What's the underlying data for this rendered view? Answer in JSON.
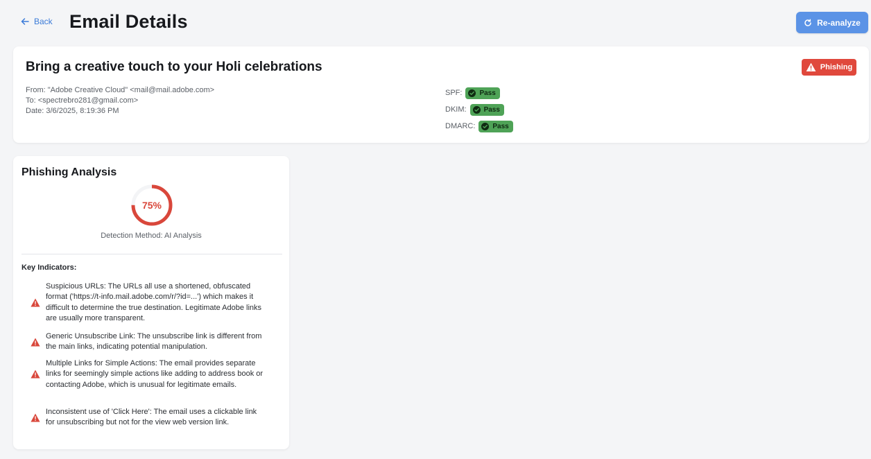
{
  "header": {
    "back_label": "Back",
    "title": "Email Details",
    "reanalyze_label": "Re-analyze"
  },
  "email": {
    "subject": "Bring a creative touch to your Holi celebrations",
    "verdict": "Phishing",
    "from": "From: \"Adobe Creative Cloud\" <mail@mail.adobe.com>",
    "to": "To: <spectrebro281@gmail.com>",
    "date": "Date: 3/6/2025, 8:19:36 PM",
    "auth": [
      {
        "label": "SPF:",
        "status": "Pass"
      },
      {
        "label": "DKIM:",
        "status": "Pass"
      },
      {
        "label": "DMARC:",
        "status": "Pass"
      }
    ]
  },
  "analysis": {
    "title": "Phishing Analysis",
    "score": 75,
    "score_label": "75%",
    "method": "Detection Method: AI Analysis",
    "key_indicators_title": "Key Indicators:",
    "indicators": [
      "Suspicious URLs: The URLs all use a shortened, obfuscated format ('https://t-info.mail.adobe.com/r/?id=...') which makes it difficult to determine the true destination. Legitimate Adobe links are usually more transparent.",
      "Generic Unsubscribe Link: The unsubscribe link is different from the main links, indicating potential manipulation.",
      "Multiple Links for Simple Actions: The email provides separate links for seemingly simple actions like adding to address book or contacting Adobe, which is unusual for legitimate emails.",
      "Inconsistent use of 'Click Here': The email uses a clickable link for unsubscribing but not for the view web version link."
    ]
  },
  "colors": {
    "accent": "#5b93e6",
    "danger": "#e0483c",
    "pass": "#4fa357",
    "link": "#3b7bd8"
  },
  "icons": [
    "arrow-left-icon",
    "refresh-icon",
    "warning-icon",
    "check-circle-icon"
  ]
}
